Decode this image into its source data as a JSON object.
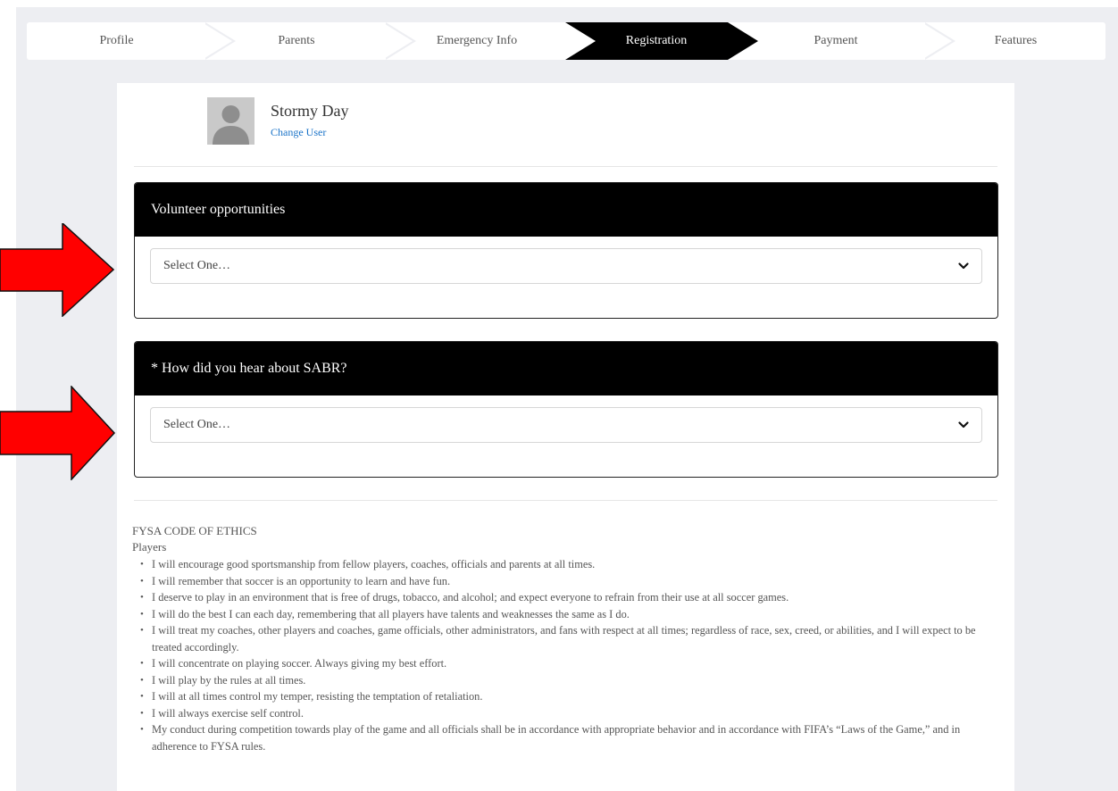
{
  "steps": [
    {
      "label": "Profile",
      "active": false
    },
    {
      "label": "Parents",
      "active": false
    },
    {
      "label": "Emergency Info",
      "active": false
    },
    {
      "label": "Registration",
      "active": true
    },
    {
      "label": "Payment",
      "active": false
    },
    {
      "label": "Features",
      "active": false
    }
  ],
  "user": {
    "name": "Stormy Day",
    "change_label": "Change User"
  },
  "questions": [
    {
      "title": "Volunteer opportunities",
      "selected": "Select One…"
    },
    {
      "title": "* How did you hear about SABR?",
      "selected": "Select One…"
    }
  ],
  "ethics": {
    "title": "FYSA CODE OF ETHICS",
    "subtitle": "Players",
    "items": [
      "I will encourage good sportsmanship from fellow players, coaches, officials and parents at all times.",
      "I will remember that soccer is an opportunity to learn and have fun.",
      "I deserve to play in an environment that is free of drugs, tobacco, and alcohol; and expect everyone to refrain from their use at all soccer games.",
      "I will do the best I can each day, remembering that all players have talents and weaknesses the same as I do.",
      "I will treat my coaches, other players and coaches, game officials, other administrators, and fans with respect at all times; regardless of race, sex, creed, or abilities, and I will expect to be treated accordingly.",
      "I will concentrate on playing soccer. Always giving my best effort.",
      "I will play by the rules at all times.",
      "I will at all times control my temper, resisting the temptation of retaliation.",
      "I will always exercise self control.",
      "My conduct during competition towards play of the game and all officials shall be in accordance with appropriate behavior and in accordance with FIFA’s “Laws of the Game,” and in adherence to FYSA rules."
    ]
  },
  "colors": {
    "active_step": "#000000",
    "link": "#1a73c8",
    "arrow": "#ff0000",
    "page_bg": "#edeef2"
  }
}
